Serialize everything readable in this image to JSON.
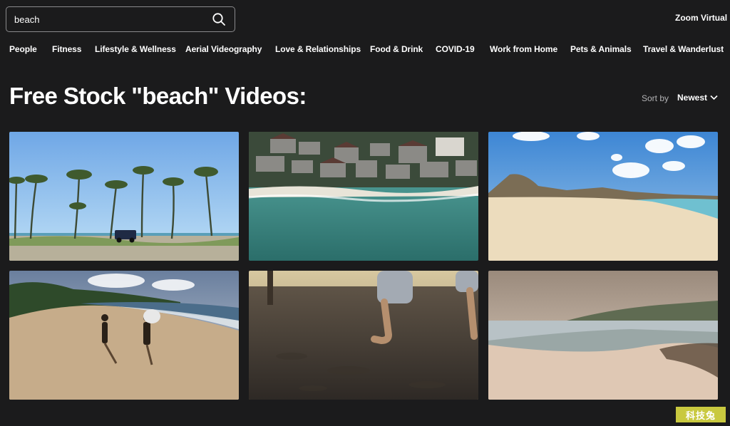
{
  "search": {
    "value": "beach",
    "placeholder": ""
  },
  "header": {
    "top_link": "Zoom Virtual B"
  },
  "categories": [
    {
      "label": "People"
    },
    {
      "label": "Fitness"
    },
    {
      "label": "Lifestyle & Wellness"
    },
    {
      "label": "Aerial Videography"
    },
    {
      "label": "Love & Relationships"
    },
    {
      "label": "Food & Drink"
    },
    {
      "label": "COVID-19"
    },
    {
      "label": "Work from Home"
    },
    {
      "label": "Pets & Animals"
    },
    {
      "label": "Travel & Wanderlust"
    }
  ],
  "main": {
    "title": "Free Stock \"beach\" Videos:",
    "sort_label": "Sort by",
    "sort_value": "Newest"
  },
  "videos": [
    {
      "icon": "palm-beach-jeep"
    },
    {
      "icon": "aerial-coastal-village"
    },
    {
      "icon": "sandy-beach-mountains"
    },
    {
      "icon": "surfers-walking-beach"
    },
    {
      "icon": "feet-in-sand"
    },
    {
      "icon": "sunset-coastline"
    }
  ],
  "watermark": {
    "text": "科技兔"
  },
  "colors": {
    "background": "#1b1b1c",
    "text": "#ffffff",
    "muted": "#b3b3b5",
    "watermark": "#c9c93f"
  }
}
